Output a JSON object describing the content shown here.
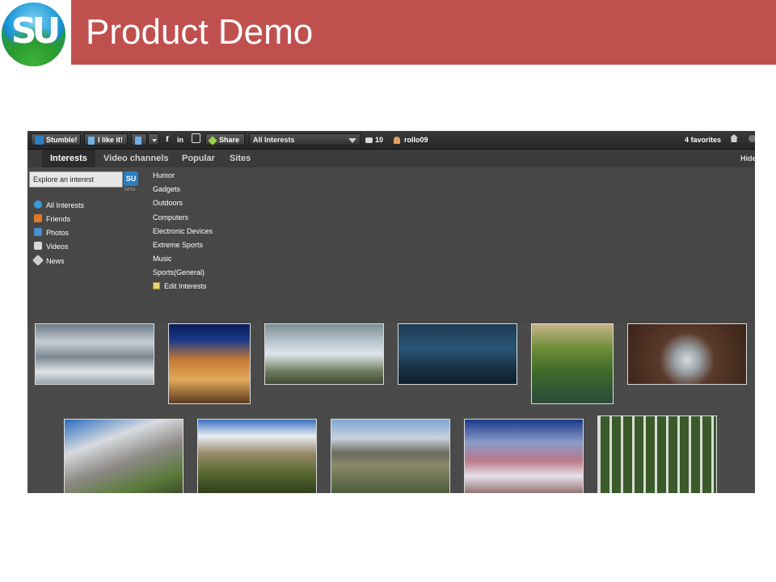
{
  "slide": {
    "logo_text": "SU",
    "title": "Product Demo"
  },
  "toolbar": {
    "stumble_label": "Stumble!",
    "ilike_label": "I like it!",
    "share_label": "Share",
    "topic_select": "All Interests",
    "count": "10",
    "username": "rollo09",
    "favorites": "4 favorites"
  },
  "tabs": [
    {
      "label": "Interests",
      "active": true
    },
    {
      "label": "Video channels",
      "active": false
    },
    {
      "label": "Popular",
      "active": false
    },
    {
      "label": "Sites",
      "active": false
    }
  ],
  "hide_label": "Hide",
  "search": {
    "placeholder": "Explore an interest",
    "beta": "beta",
    "button": "SU"
  },
  "sidebar": {
    "items": [
      {
        "label": "All Interests",
        "icon": "globe-icon",
        "color": "#3a9bd8"
      },
      {
        "label": "Friends",
        "icon": "friends-icon",
        "color": "#e07a2a"
      },
      {
        "label": "Photos",
        "icon": "photo-icon",
        "color": "#4a8fd4"
      },
      {
        "label": "Videos",
        "icon": "video-icon",
        "color": "#d9d9d9"
      },
      {
        "label": "News",
        "icon": "news-icon",
        "color": "#cfcfcf"
      }
    ]
  },
  "interests": {
    "items": [
      "Humor",
      "Gadgets",
      "Outdoors",
      "Computers",
      "Electronic Devices",
      "Extreme Sports",
      "Music",
      "Sports(General)"
    ],
    "edit_label": "Edit Interests"
  },
  "colors": {
    "title_bar": "#c0504d",
    "toolbar_bg": "#2d2d2d",
    "panel_bg": "#474747",
    "content_bg": "#4a4a4a"
  }
}
